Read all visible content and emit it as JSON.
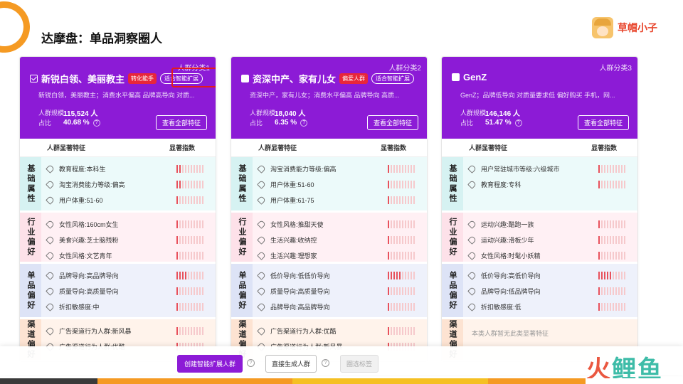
{
  "slide": {
    "title": "达摩盘：单品洞察圈人"
  },
  "brand": {
    "name": "草帽小子"
  },
  "watermark": {
    "chars": [
      "火",
      "鲤",
      "鱼"
    ]
  },
  "common": {
    "size_label": "人群规模",
    "ratio_label": "占比",
    "help_glyph": "?",
    "view_all_label": "查看全部特征",
    "feature_col_header": "人群显著特征",
    "index_col_header": "显著指数"
  },
  "cards": [
    {
      "category": "人群分类1",
      "name": "新锐白领、美丽教主",
      "checked": true,
      "tag_red": "转化能手",
      "tag_outline": "适合智能扩展",
      "desc": "新锐白领，美丽教主；消费水平偏高 品牌高导向 对质...",
      "size": "115,524 人",
      "ratio": "40.68 %",
      "groups": [
        {
          "label": "基础属性",
          "rows": [
            {
              "text": "教育程度:本科生",
              "level": 2
            },
            {
              "text": "淘宝消费能力等级:偏高",
              "level": 2
            },
            {
              "text": "用户体重:51-60",
              "level": 1
            }
          ]
        },
        {
          "label": "行业偏好",
          "rows": [
            {
              "text": "女性风格:160cm女生",
              "level": 1
            },
            {
              "text": "美食兴趣:芝士脑残粉",
              "level": 1
            },
            {
              "text": "女性风格:文艺青年",
              "level": 1
            }
          ]
        },
        {
          "label": "单品偏好",
          "rows": [
            {
              "text": "品牌导向:高品牌导向",
              "level": 4
            },
            {
              "text": "质量导向:高质量导向",
              "level": 1
            },
            {
              "text": "折扣敏感度:中",
              "level": 1
            }
          ]
        },
        {
          "label": "渠道偏好",
          "rows": [
            {
              "text": "广告渠道行为人群:新风暴",
              "level": 1
            },
            {
              "text": "广告渠道行为人群:优酷",
              "level": 1
            }
          ]
        }
      ]
    },
    {
      "category": "人群分类2",
      "name": "资深中产、家有儿女",
      "checked": false,
      "tag_red": "偏爱人群",
      "tag_outline": "适合智能扩展",
      "desc": "资深中产，家有儿女；消费水平偏高 品牌导向 高质...",
      "size": "18,040 人",
      "ratio": "6.35 %",
      "groups": [
        {
          "label": "基础属性",
          "rows": [
            {
              "text": "淘宝消费能力等级:偏高",
              "level": 1
            },
            {
              "text": "用户体重:51-60",
              "level": 1
            },
            {
              "text": "用户体重:61-75",
              "level": 1
            }
          ]
        },
        {
          "label": "行业偏好",
          "rows": [
            {
              "text": "女性风格:推甜天使",
              "level": 1
            },
            {
              "text": "生活兴趣:收纳控",
              "level": 1
            },
            {
              "text": "生活兴趣:理想家",
              "level": 1
            }
          ]
        },
        {
          "label": "单品偏好",
          "rows": [
            {
              "text": "低价导向:低低价导向",
              "level": 5
            },
            {
              "text": "质量导向:高质量导向",
              "level": 1
            },
            {
              "text": "品牌导向:高品牌导向",
              "level": 1
            }
          ]
        },
        {
          "label": "渠道偏好",
          "rows": [
            {
              "text": "广告渠道行为人群:优酷",
              "level": 1
            },
            {
              "text": "广告渠道行为人群:新风暴",
              "level": 1
            }
          ]
        }
      ]
    },
    {
      "category": "人群分类3",
      "name": "GenZ",
      "checked": false,
      "tag_red": "",
      "tag_outline": "",
      "desc": "GenZ；品牌低导向 对质量要求低 偏好购买 手机，网...",
      "size": "146,146 人",
      "ratio": "51.47 %",
      "groups": [
        {
          "label": "基础属性",
          "rows": [
            {
              "text": "用户常驻城市等级:六级城市",
              "level": 1
            },
            {
              "text": "教育程度:专科",
              "level": 1
            }
          ]
        },
        {
          "label": "行业偏好",
          "rows": [
            {
              "text": "运动兴趣:酷跑一族",
              "level": 1
            },
            {
              "text": "运动兴趣:滑板少年",
              "level": 1
            },
            {
              "text": "女性风格:时髦小妖精",
              "level": 1
            }
          ]
        },
        {
          "label": "单品偏好",
          "rows": [
            {
              "text": "低价导向:高低价导向",
              "level": 5
            },
            {
              "text": "品牌导向:低品牌导向",
              "level": 1
            },
            {
              "text": "折扣敏感度:低",
              "level": 1
            }
          ]
        },
        {
          "label": "渠道偏好",
          "empty": "本类人群暂无此类显著特征",
          "rows": []
        }
      ]
    }
  ],
  "actions": {
    "create_label": "创建智能扩展人群",
    "direct_label": "直接生成人群",
    "filter_label": "圈选标签"
  },
  "colors": {
    "accent_purple": "#8c1bd6",
    "tag_red": "#e8263a",
    "bar_on": "#e8515c",
    "bar_off": "#f6c9cc",
    "footer": [
      "#3a3a3a",
      "#f59a23",
      "#f59a23",
      "#f5c023",
      "#f5c023",
      "#f59a23",
      "#ffffff"
    ]
  }
}
